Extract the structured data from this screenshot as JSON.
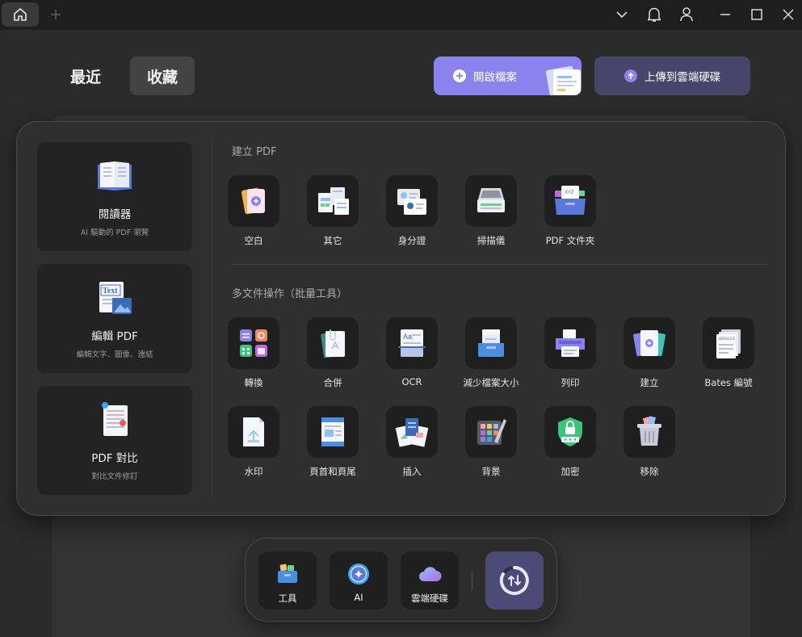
{
  "titlebar": {
    "home_icon": "home-icon",
    "add_tab_icon": "plus-icon",
    "controls": [
      "chevron-down-icon",
      "bell-icon",
      "user-icon",
      "minimize-icon",
      "maximize-icon",
      "close-icon"
    ]
  },
  "nav": {
    "recent": "最近",
    "favorites": "收藏"
  },
  "actions": {
    "open_file": "開啟檔案",
    "upload_cloud": "上傳到雲端硬碟"
  },
  "features": [
    {
      "title": "閱讀器",
      "subtitle": "AI 驅動的 PDF 瀏覽"
    },
    {
      "title": "編輯 PDF",
      "subtitle": "編輯文字、圖像、連結"
    },
    {
      "title": "PDF 對比",
      "subtitle": "對比文件修訂"
    }
  ],
  "create_section": {
    "title": "建立 PDF",
    "tools": [
      "空白",
      "其它",
      "身分證",
      "掃描儀",
      "PDF 文件夾"
    ]
  },
  "batch_section": {
    "title": "多文件操作（批量工具）",
    "tools_row1": [
      "轉換",
      "合併",
      "OCR",
      "減少檔案大小",
      "列印",
      "建立",
      "Bates 編號"
    ],
    "tools_row2": [
      "水印",
      "頁首和頁尾",
      "插入",
      "背景",
      "加密",
      "移除"
    ]
  },
  "icon_text": {
    "edit_text": "Text",
    "ocr_text": "Aa",
    "bates_number": "000123",
    "folder_text": "XYZ"
  },
  "dock": {
    "tools": "工具",
    "ai": "AI",
    "cloud": "雲端硬碟",
    "sync_icon": "sync-icon"
  },
  "colors": {
    "accent": "#8a83ee",
    "upload": "#46466a",
    "sync": "#4c4b78",
    "panel": "#2f2f30",
    "tile": "#1f1f20"
  }
}
